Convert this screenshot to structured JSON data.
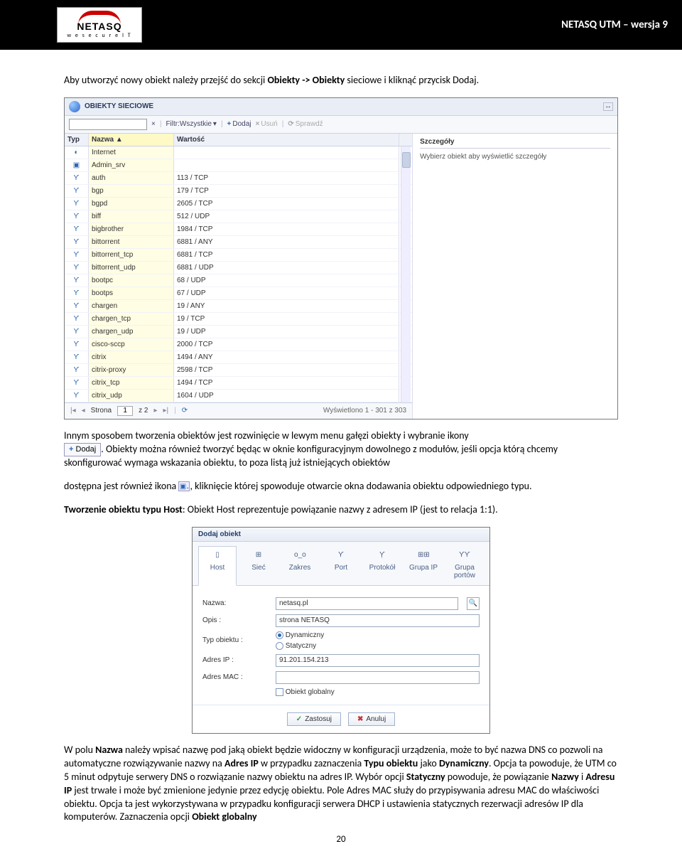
{
  "header": {
    "logo_main": "NETASQ",
    "logo_tag": "w e   s e c u r e   I T",
    "right": "NETASQ UTM – wersja 9"
  },
  "p1": {
    "pre": "Aby utworzyć nowy obiekt należy przejść do sekcji ",
    "b1": "Obiekty -> Obiekty",
    "post1": " sieciowe i kliknąć przycisk Dodaj."
  },
  "shot1": {
    "title": "OBIEKTY SIECIOWE",
    "expand": "↔",
    "toolbar": {
      "clear": "×",
      "filter": "Filtr:Wszystkie",
      "drop": "▾",
      "add": "Dodaj",
      "del": "Usuń",
      "chk": "Sprawdź",
      "plus": "+",
      "x": "×",
      "eye": "⟳"
    },
    "head": {
      "typ": "Typ",
      "nazwa": "Nazwa",
      "sort": "▲",
      "wart": "Wartość"
    },
    "rows": [
      {
        "ico": "◐",
        "n": "Internet",
        "v": ""
      },
      {
        "ico": "▣",
        "n": "Admin_srv",
        "v": ""
      },
      {
        "ico": "Ƴ",
        "n": "auth",
        "v": "113 / TCP"
      },
      {
        "ico": "Ƴ",
        "n": "bgp",
        "v": "179 / TCP"
      },
      {
        "ico": "Ƴ",
        "n": "bgpd",
        "v": "2605 / TCP"
      },
      {
        "ico": "Ƴ",
        "n": "biff",
        "v": "512 / UDP"
      },
      {
        "ico": "Ƴ",
        "n": "bigbrother",
        "v": "1984 / TCP"
      },
      {
        "ico": "Ƴ",
        "n": "bittorrent",
        "v": "6881 / ANY"
      },
      {
        "ico": "Ƴ",
        "n": "bittorrent_tcp",
        "v": "6881 / TCP"
      },
      {
        "ico": "Ƴ",
        "n": "bittorrent_udp",
        "v": "6881 / UDP"
      },
      {
        "ico": "Ƴ",
        "n": "bootpc",
        "v": "68 / UDP"
      },
      {
        "ico": "Ƴ",
        "n": "bootps",
        "v": "67 / UDP"
      },
      {
        "ico": "Ƴ",
        "n": "chargen",
        "v": "19 / ANY"
      },
      {
        "ico": "Ƴ",
        "n": "chargen_tcp",
        "v": "19 / TCP"
      },
      {
        "ico": "Ƴ",
        "n": "chargen_udp",
        "v": "19 / UDP"
      },
      {
        "ico": "Ƴ",
        "n": "cisco-sccp",
        "v": "2000 / TCP"
      },
      {
        "ico": "Ƴ",
        "n": "citrix",
        "v": "1494 / ANY"
      },
      {
        "ico": "Ƴ",
        "n": "citrix-proxy",
        "v": "2598 / TCP"
      },
      {
        "ico": "Ƴ",
        "n": "citrix_tcp",
        "v": "1494 / TCP"
      },
      {
        "ico": "Ƴ",
        "n": "citrix_udp",
        "v": "1604 / UDP"
      }
    ],
    "side": {
      "h": "Szczegóły",
      "msg": "Wybierz obiekt aby wyświetlić szczegóły"
    },
    "pager": {
      "first": "|◂",
      "prev": "◂",
      "label": "Strona",
      "val": "1",
      "of": "z 2",
      "next": "▸",
      "last": "▸|",
      "refresh": "⟳",
      "count": "Wyświetlono 1 - 301 z 303"
    }
  },
  "p2": "Innym sposobem tworzenia obiektów jest rozwinięcie w lewym menu gałęzi obiekty i wybranie ikony",
  "dodaj_btn": {
    "plus": "+",
    "label": "Dodaj"
  },
  "p2b": ". Obiekty można również tworzyć będąc w oknie konfiguracyjnym dowolnego z modułów, jeśli opcja którą chcemy skonfigurować wymaga wskazania obiektu, to poza listą już istniejących obiektów",
  "p3a": "dostępna jest również ikona ",
  "p3_ico": "▣₊",
  "p3b": ", kliknięcie której spowoduje otwarcie okna dodawania obiektu odpowiedniego typu.",
  "p4a": "Tworzenie obiektu typu Host",
  "p4b": ": Obiekt Host reprezentuje powiązanie nazwy z adresem IP (jest to relacja 1:1).",
  "shot2": {
    "title": "Dodaj obiekt",
    "tabs": [
      {
        "ico": "▯",
        "l": "Host"
      },
      {
        "ico": "⊞",
        "l": "Sieć"
      },
      {
        "ico": "o_o",
        "l": "Zakres"
      },
      {
        "ico": "Ƴ",
        "l": "Port"
      },
      {
        "ico": "Ƴ̣",
        "l": "Protokół"
      },
      {
        "ico": "⊞⊞",
        "l": "Grupa IP"
      },
      {
        "ico": "ƳƳ",
        "l": "Grupa portów"
      }
    ],
    "nazwa_l": "Nazwa:",
    "nazwa_v": "netasq.pl",
    "lookup": "🔍",
    "opis_l": "Opis :",
    "opis_v": "strona NETASQ",
    "typ_l": "Typ obiektu :",
    "typ_dyn": "Dynamiczny",
    "typ_stat": "Statyczny",
    "ip_l": "Adres IP :",
    "ip_v": "91.201.154.213",
    "mac_l": "Adres MAC :",
    "mac_v": "",
    "glob": "Obiekt globalny",
    "apply": "Zastosuj",
    "cancel": "Anuluj",
    "ok": "✓",
    "x": "✖"
  },
  "p5": {
    "a": "W polu ",
    "b1": "Nazwa",
    "b": " należy wpisać nazwę pod jaką obiekt będzie widoczny w konfiguracji urządzenia, może to być nazwa DNS co pozwoli na automatyczne rozwiązywanie nazwy na ",
    "b2": "Adres IP",
    "c": " w przypadku zaznaczenia ",
    "b3": "Typu obiektu",
    "d": " jako ",
    "b4": "Dynamiczny",
    "e": ". Opcja ta powoduje, że UTM co 5 minut odpytuje serwery DNS o rozwiązanie nazwy obiektu na adres IP. Wybór opcji ",
    "b5": "Statyczny",
    "f": " powoduje, że powiązanie ",
    "b6": "Nazwy",
    "g": " i ",
    "b7": "Adresu IP",
    "h": " jest trwałe i może być zmienione jedynie przez edycję obiektu. Pole Adres MAC służy do przypisywania adresu MAC do właściwości obiektu. Opcja ta jest wykorzystywana w przypadku konfiguracji serwera DHCP i ustawienia statycznych rezerwacji adresów IP dla komputerów. Zaznaczenia opcji ",
    "b8": "Obiekt globalny"
  },
  "pagenum": "20"
}
